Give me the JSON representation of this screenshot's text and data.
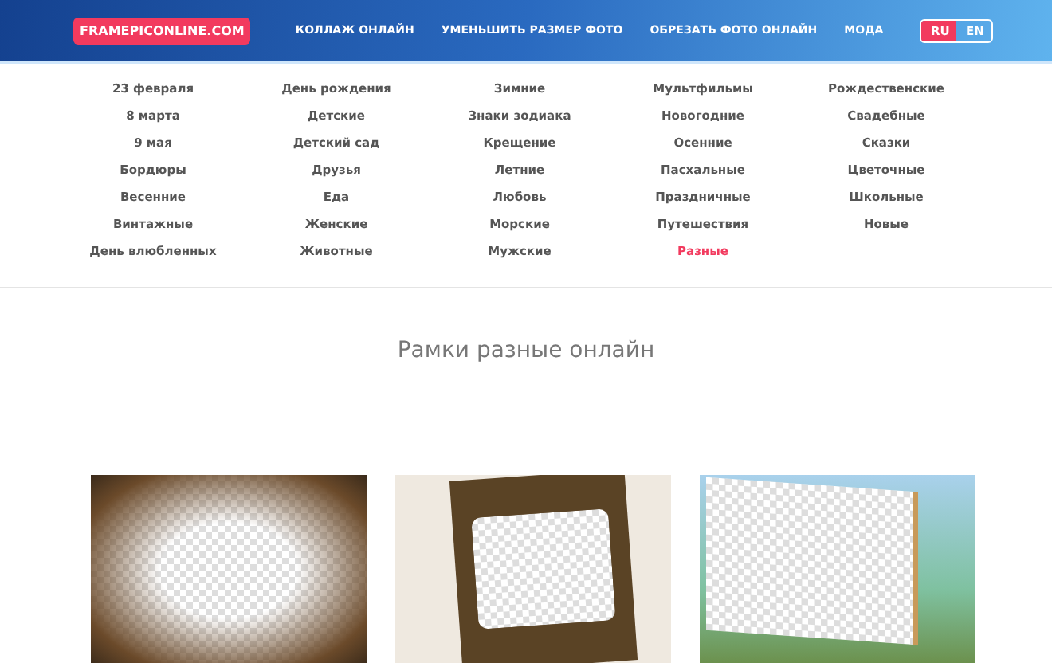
{
  "header": {
    "logo": "FRAMEPICONLINE.COM",
    "nav": [
      "КОЛЛАЖ ОНЛАЙН",
      "УМЕНЬШИТЬ РАЗМЕР ФОТО",
      "ОБРЕЗАТЬ ФОТО ОНЛАЙН",
      "МОДА"
    ],
    "languages": [
      {
        "label": "RU",
        "selected": true
      },
      {
        "label": "EN",
        "selected": false
      }
    ]
  },
  "categories": [
    [
      {
        "label": "23 февраля",
        "selected": false
      },
      {
        "label": "8 марта",
        "selected": false
      },
      {
        "label": "9 мая",
        "selected": false
      },
      {
        "label": "Бордюры",
        "selected": false
      },
      {
        "label": "Весенние",
        "selected": false
      },
      {
        "label": "Винтажные",
        "selected": false
      },
      {
        "label": "День влюбленных",
        "selected": false
      }
    ],
    [
      {
        "label": "День рождения",
        "selected": false
      },
      {
        "label": "Детские",
        "selected": false
      },
      {
        "label": "Детский сад",
        "selected": false
      },
      {
        "label": "Друзья",
        "selected": false
      },
      {
        "label": "Еда",
        "selected": false
      },
      {
        "label": "Женские",
        "selected": false
      },
      {
        "label": "Животные",
        "selected": false
      }
    ],
    [
      {
        "label": "Зимние",
        "selected": false
      },
      {
        "label": "Знаки зодиака",
        "selected": false
      },
      {
        "label": "Крещение",
        "selected": false
      },
      {
        "label": "Летние",
        "selected": false
      },
      {
        "label": "Любовь",
        "selected": false
      },
      {
        "label": "Морские",
        "selected": false
      },
      {
        "label": "Мужские",
        "selected": false
      }
    ],
    [
      {
        "label": "Мультфильмы",
        "selected": false
      },
      {
        "label": "Новогодние",
        "selected": false
      },
      {
        "label": "Осенние",
        "selected": false
      },
      {
        "label": "Пасхальные",
        "selected": false
      },
      {
        "label": "Праздничные",
        "selected": false
      },
      {
        "label": "Путешествия",
        "selected": false
      },
      {
        "label": "Разные",
        "selected": true
      }
    ],
    [
      {
        "label": "Рождественские",
        "selected": false
      },
      {
        "label": "Свадебные",
        "selected": false
      },
      {
        "label": "Сказки",
        "selected": false
      },
      {
        "label": "Цветочные",
        "selected": false
      },
      {
        "label": "Школьные",
        "selected": false
      },
      {
        "label": "Новые",
        "selected": false
      }
    ]
  ],
  "page_title": "Рамки разные онлайн",
  "frames": [
    {
      "kind": "grunge"
    },
    {
      "kind": "film"
    },
    {
      "kind": "easel"
    }
  ]
}
